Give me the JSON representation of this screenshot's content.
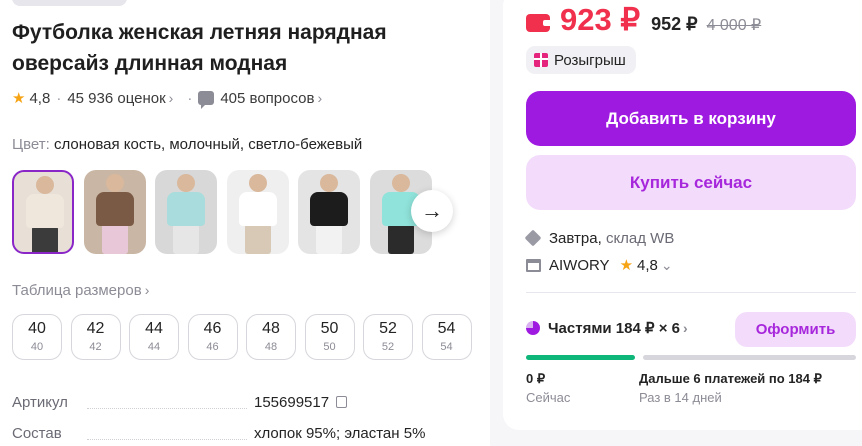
{
  "product": {
    "title_line1": "Футболка женская летняя нарядная",
    "title_line2": "оверсайз длинная модная",
    "rating": "4,8",
    "reviews": "45 936 оценок",
    "questions": "405 вопросов",
    "color_label": "Цвет:",
    "color_value": "слоновая кость, молочный, светло-бежевый",
    "thumbnails": [
      {
        "shirt": "#efe6dc",
        "legs": "#3b3b3b",
        "bg": "#e8dfd6"
      },
      {
        "shirt": "#7a5a44",
        "legs": "#e8c7d8",
        "bg": "#c9b6a4"
      },
      {
        "shirt": "#a9dcdc",
        "legs": "#e6e6e6",
        "bg": "#d8d8d8"
      },
      {
        "shirt": "#ffffff",
        "legs": "#d7c9b5",
        "bg": "#efefef"
      },
      {
        "shirt": "#1c1c1c",
        "legs": "#f2f2f2",
        "bg": "#e4e4e4"
      },
      {
        "shirt": "#8fe3da",
        "legs": "#2b2b2b",
        "bg": "#dcdcdc"
      }
    ],
    "sizes_link": "Таблица размеров",
    "sizes": [
      {
        "big": "40",
        "small": "40"
      },
      {
        "big": "42",
        "small": "42"
      },
      {
        "big": "44",
        "small": "44"
      },
      {
        "big": "46",
        "small": "46"
      },
      {
        "big": "48",
        "small": "48"
      },
      {
        "big": "50",
        "small": "50"
      },
      {
        "big": "52",
        "small": "52"
      },
      {
        "big": "54",
        "small": "54"
      }
    ],
    "specs": [
      {
        "key": "Артикул",
        "value": "155699517"
      },
      {
        "key": "Состав",
        "value": "хлопок 95%; эластан 5%"
      }
    ]
  },
  "buy_panel": {
    "price": "923 ₽",
    "price_no_discount": "952 ₽",
    "price_old": "4 000 ₽",
    "promo": "Розыгрыш",
    "add_to_cart": "Добавить в корзину",
    "buy_now": "Купить сейчас",
    "delivery_day": "Завтра,",
    "delivery_place": "склад WB",
    "seller": "AIWORY",
    "seller_rating": "4,8",
    "installment": "Частями 184 ₽ × 6",
    "checkout": "Оформить",
    "pay_now_amount": "0 ₽",
    "pay_now_label": "Сейчас",
    "pay_later_amount": "Дальше 6 платежей по 184 ₽",
    "pay_later_label": "Раз в 14 дней",
    "paid_fraction": 0.33
  },
  "colors": {
    "accent": "#9f1ae0",
    "price_red": "#f0304d",
    "progress_green": "#0fb67a",
    "star": "#f6a314"
  },
  "icons": [
    "star-icon",
    "chevron-right-icon",
    "question-icon",
    "arrow-right-icon",
    "copy-icon",
    "wallet-icon",
    "gift-icon",
    "box-icon",
    "store-icon",
    "chevron-down-icon",
    "pie-icon"
  ]
}
